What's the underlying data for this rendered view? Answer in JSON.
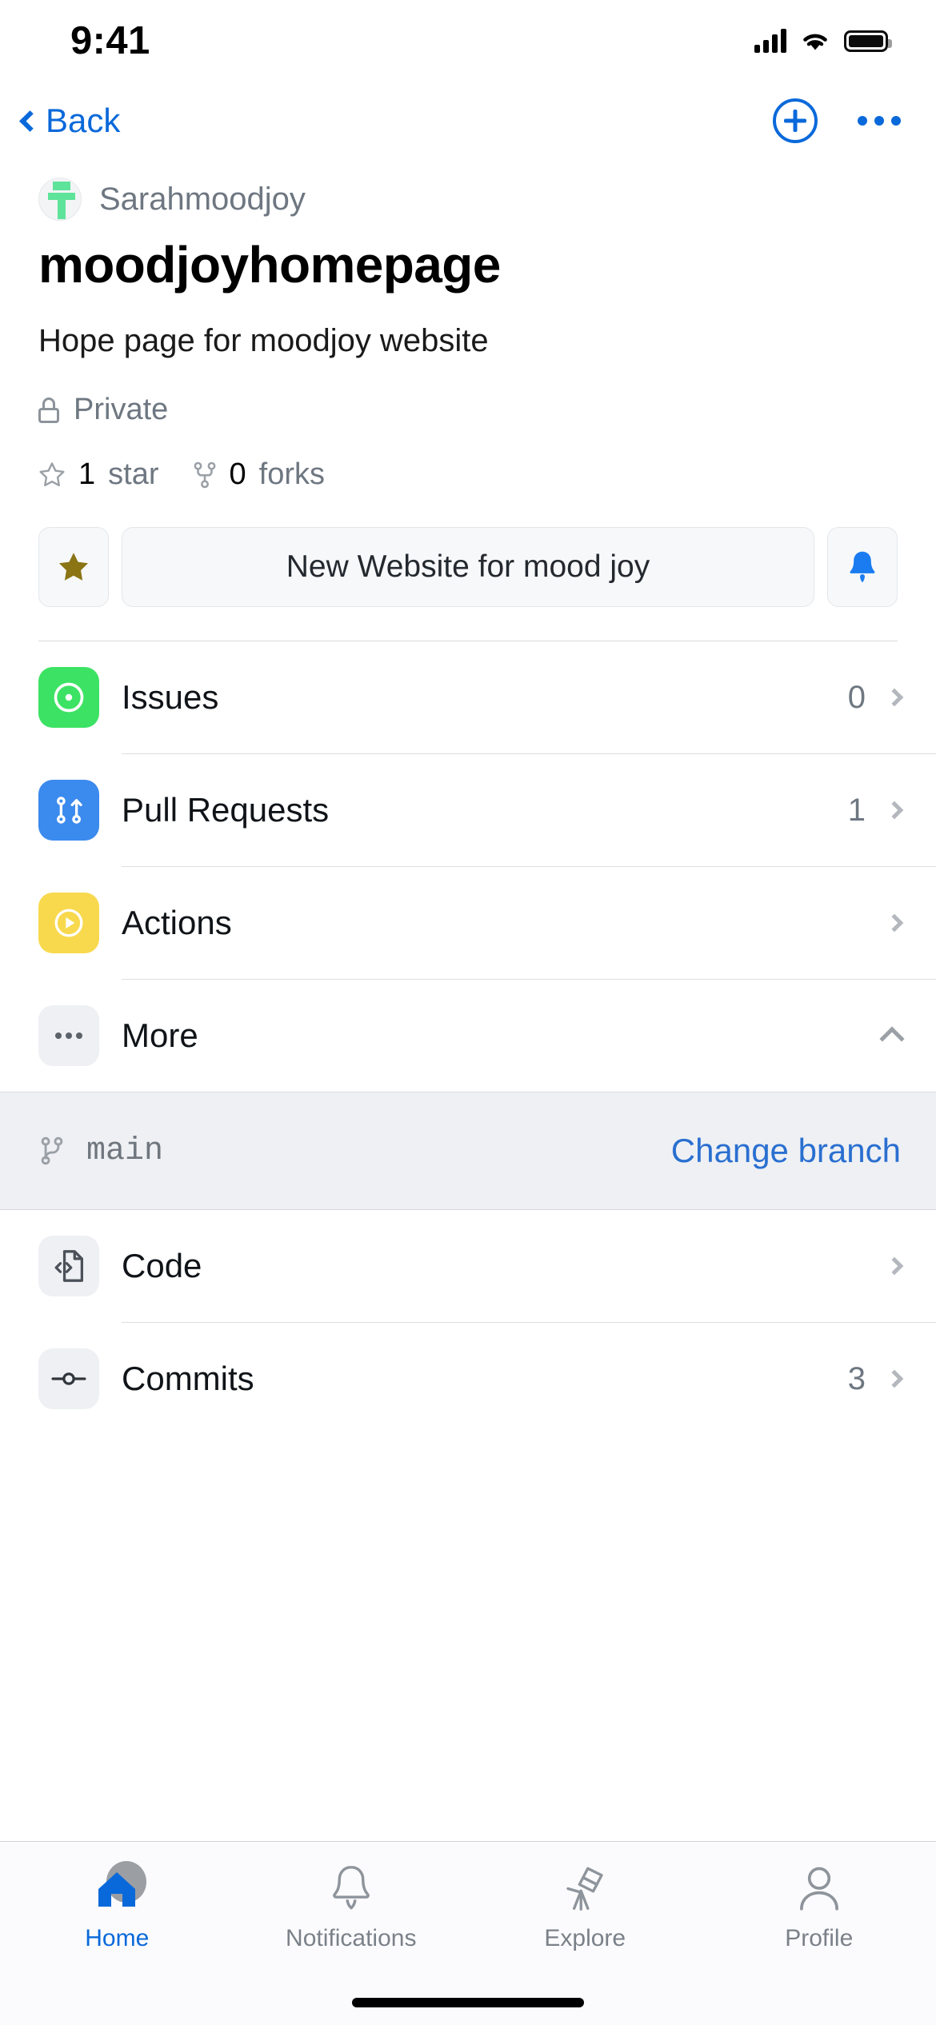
{
  "status_bar": {
    "time": "9:41",
    "signal_icon": "cellular-signal-icon",
    "wifi_icon": "wifi-icon",
    "battery_icon": "battery-icon"
  },
  "nav": {
    "back_label": "Back",
    "back_icon": "chevron-left-icon",
    "add_icon": "plus-circle-icon",
    "more_icon": "ellipsis-icon"
  },
  "repo": {
    "owner": "Sarahmoodjoy",
    "avatar_icon": "owner-avatar-identicon",
    "name": "moodjoyhomepage",
    "description": "Hope page for moodjoy website",
    "visibility": "Private",
    "visibility_icon": "lock-icon",
    "stars": {
      "count": "1",
      "label": "star",
      "icon": "star-outline-icon"
    },
    "forks": {
      "count": "0",
      "label": "forks",
      "icon": "fork-icon"
    }
  },
  "actions": {
    "star_icon": "star-filled-icon",
    "primary_label": "New Website for mood joy",
    "watch_icon": "bell-filled-icon"
  },
  "menu": [
    {
      "label": "Issues",
      "count": "0",
      "icon": "issue-opened-icon",
      "accent": "#3ce264",
      "chevron": "chevron-right-icon"
    },
    {
      "label": "Pull Requests",
      "count": "1",
      "icon": "git-pull-request-icon",
      "accent": "#3b8aee",
      "chevron": "chevron-right-icon"
    },
    {
      "label": "Actions",
      "count": "",
      "icon": "play-circle-icon",
      "accent": "#f8d94e",
      "chevron": "chevron-right-icon"
    },
    {
      "label": "More",
      "count": "",
      "icon": "ellipsis-icon",
      "accent": "#eef0f3",
      "chevron": "chevron-up-icon"
    }
  ],
  "branch": {
    "icon": "git-branch-icon",
    "name": "main",
    "change_label": "Change branch"
  },
  "sub_menu": [
    {
      "label": "Code",
      "count": "",
      "icon": "file-code-icon",
      "chevron": "chevron-right-icon"
    },
    {
      "label": "Commits",
      "count": "3",
      "icon": "git-commit-icon",
      "chevron": "chevron-right-icon"
    }
  ],
  "tabs": [
    {
      "label": "Home",
      "icon": "home-icon",
      "active": true
    },
    {
      "label": "Notifications",
      "icon": "bell-outline-icon",
      "active": false
    },
    {
      "label": "Explore",
      "icon": "telescope-icon",
      "active": false
    },
    {
      "label": "Profile",
      "icon": "person-icon",
      "active": false
    }
  ],
  "colors": {
    "accent_blue": "#0a69da",
    "link_blue": "#2a6fd0",
    "star_gold": "#8a7414",
    "bell_blue": "#1a7cf0",
    "issues_green": "#3ce264",
    "pr_blue": "#3b8aee",
    "actions_yellow": "#f8d94e",
    "muted_gray": "#6e7781"
  }
}
